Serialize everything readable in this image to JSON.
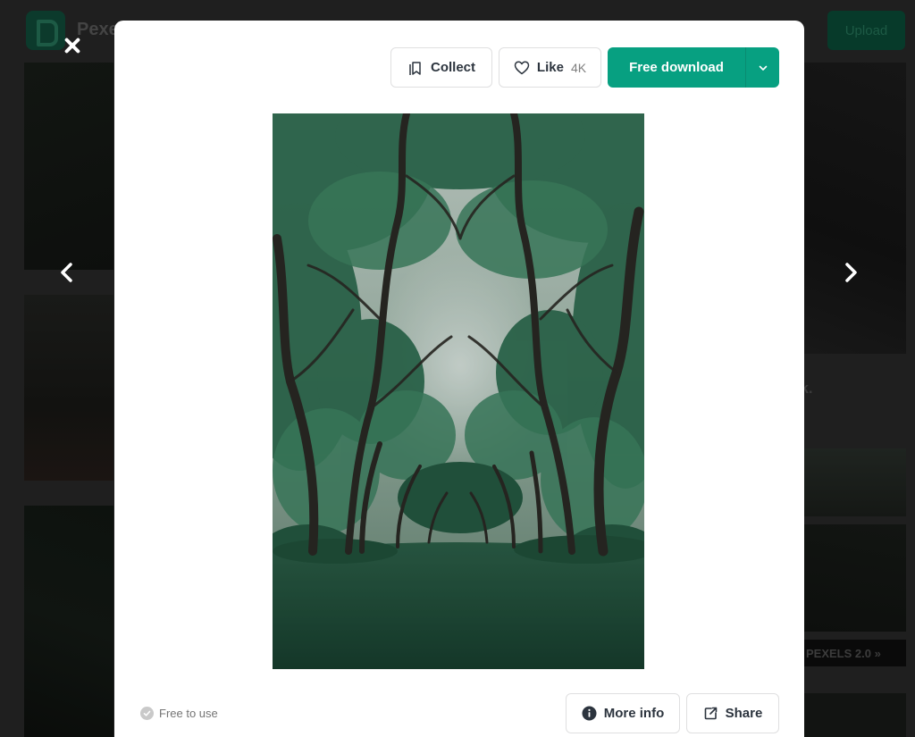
{
  "background": {
    "brand_text": "Pexe",
    "upload_label": "Upload",
    "side_text": "ck.",
    "banner_text": "PEXELS 2.0 »"
  },
  "modal": {
    "actions": {
      "collect_label": "Collect",
      "like_label": "Like",
      "like_count": "4K",
      "download_label": "Free download"
    },
    "photo": {
      "subject": "Tree-lined park avenue with green canopy and lawn"
    },
    "footer": {
      "license_label": "Free to use",
      "more_info_label": "More info",
      "share_label": "Share"
    }
  },
  "icons": {
    "close": "close-icon",
    "prev": "chevron-left-icon",
    "next": "chevron-right-icon",
    "collect": "bookmark-icon",
    "like": "heart-icon",
    "download_menu": "chevron-down-icon",
    "license": "check-circle-icon",
    "info": "info-icon",
    "share": "external-link-icon"
  },
  "colors": {
    "accent": "#07a081",
    "backdrop": "#1f1f1f",
    "modal_bg": "#ffffff",
    "text": "#2c343e"
  }
}
